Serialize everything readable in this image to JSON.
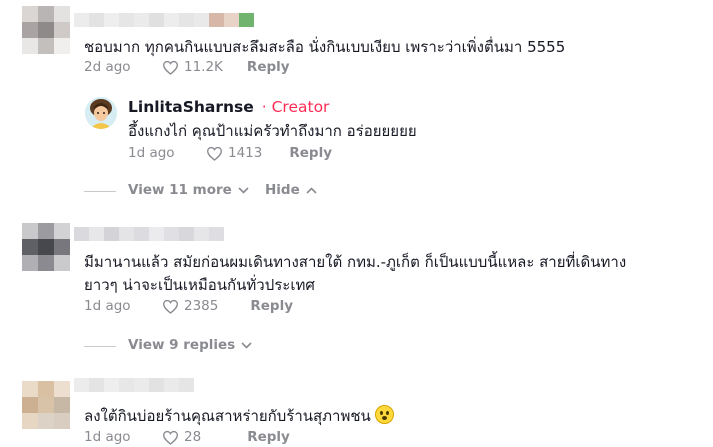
{
  "comments": [
    {
      "text": "ชอบมาก ทุกคนกินแบบสะลึมสะลือ นั่งกินเบบเงียบ เพราะว่าเพิ่งตื่นมา 5555",
      "time": "2d ago",
      "likes": "11.2K",
      "reply_label": "Reply",
      "reply_thread": {
        "author": "LinlitaSharnse",
        "separator": "·",
        "badge": "Creator",
        "text": "อึ้งแกงไก่ คุณป้าแม่ครัวทำถึงมาก อร่อยยยยย",
        "time": "1d ago",
        "likes": "1413",
        "reply_label": "Reply"
      },
      "view_more_label": "View 11 more",
      "hide_label": "Hide"
    },
    {
      "text_line1": "มีมานานแล้ว สมัยก่อนผมเดินทางสายใต้ กทม.-ภูเก็ต ก็เป็นแบบนี้แหละ สายที่เดินทาง",
      "text_line2": "ยาวๆ น่าจะเป็นเหมือนกันทั่วประเทศ",
      "time": "1d ago",
      "likes": "2385",
      "reply_label": "Reply",
      "view_replies_label": "View 9 replies"
    },
    {
      "text": "ลงใต้กินบ่อยร้านคุณสาหร่ายกับร้านสุภาพชน",
      "time": "1d ago",
      "likes": "28",
      "reply_label": "Reply"
    }
  ],
  "colors": {
    "creator_badge": "#fe2c55",
    "muted": "#8a8b91",
    "text": "#161823"
  },
  "icons": [
    "heart-icon",
    "chevron-down-icon",
    "chevron-up-icon",
    "smiling-face-emoji"
  ]
}
